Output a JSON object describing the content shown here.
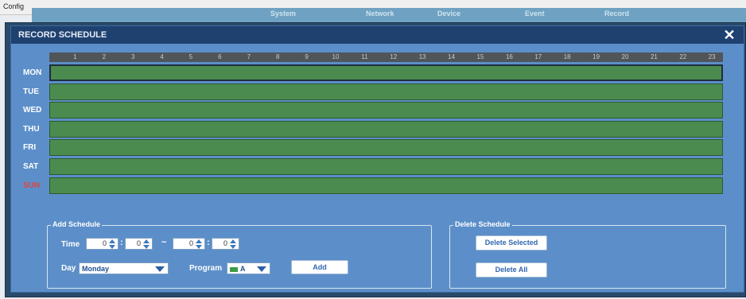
{
  "window": {
    "title": "Config"
  },
  "background_nav": [
    "System",
    "Network",
    "Device",
    "Event",
    "Record"
  ],
  "modal": {
    "title": "RECORD SCHEDULE",
    "close_glyph": "✕"
  },
  "hours": [
    "1",
    "2",
    "3",
    "4",
    "5",
    "6",
    "7",
    "8",
    "9",
    "10",
    "11",
    "12",
    "13",
    "14",
    "15",
    "16",
    "17",
    "18",
    "19",
    "20",
    "21",
    "22",
    "23"
  ],
  "days": [
    {
      "label": "MON",
      "selected": true
    },
    {
      "label": "TUE"
    },
    {
      "label": "WED"
    },
    {
      "label": "THU"
    },
    {
      "label": "FRI"
    },
    {
      "label": "SAT"
    },
    {
      "label": "SUN",
      "color": "#e0433c"
    }
  ],
  "colors": {
    "schedule_fill": "#4b8b4f",
    "modal_bg": "#5c8fc9",
    "header_bg": "#1e4170"
  },
  "add_schedule": {
    "legend": "Add Schedule",
    "time_label": "Time",
    "start_hour": "0",
    "start_minute": "0",
    "separator": "~",
    "end_hour": "0",
    "end_minute": "0",
    "day_label": "Day",
    "day_value": "Monday",
    "program_label": "Program",
    "program_value": "A",
    "add_button": "Add"
  },
  "delete_schedule": {
    "legend": "Delete Schedule",
    "delete_selected_button": "Delete Selected",
    "delete_all_button": "Delete All"
  }
}
